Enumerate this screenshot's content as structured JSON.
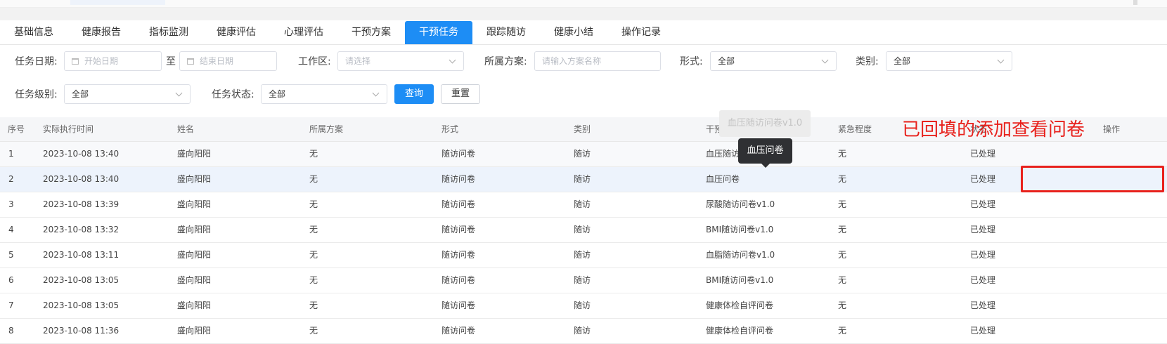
{
  "tabs": [
    {
      "label": "基础信息",
      "active": false
    },
    {
      "label": "健康报告",
      "active": false
    },
    {
      "label": "指标监测",
      "active": false
    },
    {
      "label": "健康评估",
      "active": false
    },
    {
      "label": "心理评估",
      "active": false
    },
    {
      "label": "干预方案",
      "active": false
    },
    {
      "label": "干预任务",
      "active": true
    },
    {
      "label": "跟踪随访",
      "active": false
    },
    {
      "label": "健康小结",
      "active": false
    },
    {
      "label": "操作记录",
      "active": false
    }
  ],
  "filters": {
    "task_date_label": "任务日期:",
    "start_date_placeholder": "开始日期",
    "to_label": "至",
    "end_date_placeholder": "结束日期",
    "workarea_label": "工作区:",
    "workarea_placeholder": "请选择",
    "plan_label": "所属方案:",
    "plan_placeholder": "请输入方案名称",
    "form_label": "形式:",
    "form_value": "全部",
    "category_label": "类别:",
    "category_value": "全部",
    "level_label": "任务级别:",
    "level_value": "全部",
    "status_label": "任务状态:",
    "status_value": "全部",
    "query_button": "查询",
    "reset_button": "重置"
  },
  "table": {
    "headers": {
      "index": "序号",
      "time": "实际执行时间",
      "name": "姓名",
      "plan": "所属方案",
      "form": "形式",
      "category": "类别",
      "content": "干预内容",
      "urgency": "紧急程度",
      "status": "状态",
      "action": "操作"
    },
    "rows": [
      {
        "index": "1",
        "time": "2023-10-08 13:40",
        "name": "盛向阳阳",
        "plan": "无",
        "form": "随访问卷",
        "category": "随访",
        "content": "血压随访问卷v1.0",
        "urgency": "无",
        "status": "已处理"
      },
      {
        "index": "2",
        "time": "2023-10-08 13:40",
        "name": "盛向阳阳",
        "plan": "无",
        "form": "随访问卷",
        "category": "随访",
        "content": "血压问卷",
        "urgency": "无",
        "status": "已处理"
      },
      {
        "index": "3",
        "time": "2023-10-08 13:39",
        "name": "盛向阳阳",
        "plan": "无",
        "form": "随访问卷",
        "category": "随访",
        "content": "尿酸随访问卷v1.0",
        "urgency": "无",
        "status": "已处理"
      },
      {
        "index": "4",
        "time": "2023-10-08 13:32",
        "name": "盛向阳阳",
        "plan": "无",
        "form": "随访问卷",
        "category": "随访",
        "content": "BMI随访问卷v1.0",
        "urgency": "无",
        "status": "已处理"
      },
      {
        "index": "5",
        "time": "2023-10-08 13:11",
        "name": "盛向阳阳",
        "plan": "无",
        "form": "随访问卷",
        "category": "随访",
        "content": "血脂随访问卷v1.0",
        "urgency": "无",
        "status": "已处理"
      },
      {
        "index": "6",
        "time": "2023-10-08 13:05",
        "name": "盛向阳阳",
        "plan": "无",
        "form": "随访问卷",
        "category": "随访",
        "content": "BMI随访问卷v1.0",
        "urgency": "无",
        "status": "已处理"
      },
      {
        "index": "7",
        "time": "2023-10-08 13:05",
        "name": "盛向阳阳",
        "plan": "无",
        "form": "随访问卷",
        "category": "随访",
        "content": "健康体检自评问卷",
        "urgency": "无",
        "status": "已处理"
      },
      {
        "index": "8",
        "time": "2023-10-08 11:36",
        "name": "盛向阳阳",
        "plan": "无",
        "form": "随访问卷",
        "category": "随访",
        "content": "健康体检自评问卷",
        "urgency": "无",
        "status": "已处理"
      }
    ]
  },
  "ghost_tooltip": "血压随访问卷v1.0",
  "tooltip": "血压问卷",
  "annotation": "已回填的添加查看问卷",
  "colors": {
    "accent": "#1d8df5",
    "annotation": "#e8211c"
  }
}
